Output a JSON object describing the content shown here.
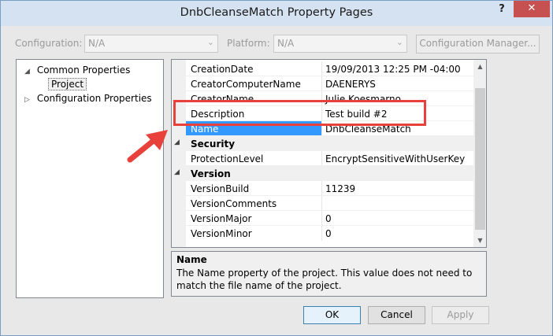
{
  "window": {
    "title": "DnbCleanseMatch Property Pages",
    "help_glyph": "?",
    "close_glyph": "✕"
  },
  "config_bar": {
    "configuration_label": "Configuration:",
    "configuration_value": "N/A",
    "platform_label": "Platform:",
    "platform_value": "N/A",
    "manager_button": "Configuration Manager..."
  },
  "tree": {
    "items": [
      {
        "label": "Common Properties",
        "expanded": true
      },
      {
        "label": "Project",
        "selected": true
      },
      {
        "label": "Configuration Properties",
        "expanded": false
      }
    ]
  },
  "grid": {
    "rows": [
      {
        "name": "CreationDate",
        "value": "19/09/2013 12:25 PM -04:00"
      },
      {
        "name": "CreatorComputerName",
        "value": "DAENERYS"
      },
      {
        "name": "CreatorName",
        "value": "Julie Koesmarno"
      },
      {
        "name": "Description",
        "value": "Test build #2"
      },
      {
        "name": "Name",
        "value": "DnbCleanseMatch",
        "selected": true
      },
      {
        "category": "Security"
      },
      {
        "name": "ProtectionLevel",
        "value": "EncryptSensitiveWithUserKey"
      },
      {
        "category": "Version"
      },
      {
        "name": "VersionBuild",
        "value": "11239"
      },
      {
        "name": "VersionComments",
        "value": ""
      },
      {
        "name": "VersionMajor",
        "value": "0"
      },
      {
        "name": "VersionMinor",
        "value": "0"
      }
    ]
  },
  "description_panel": {
    "title": "Name",
    "text": "The Name property of the project. This value does not need to match the file name of the project."
  },
  "buttons": {
    "ok": "OK",
    "cancel": "Cancel",
    "apply": "Apply"
  },
  "annotation": {
    "highlight_color": "#e8413b"
  }
}
